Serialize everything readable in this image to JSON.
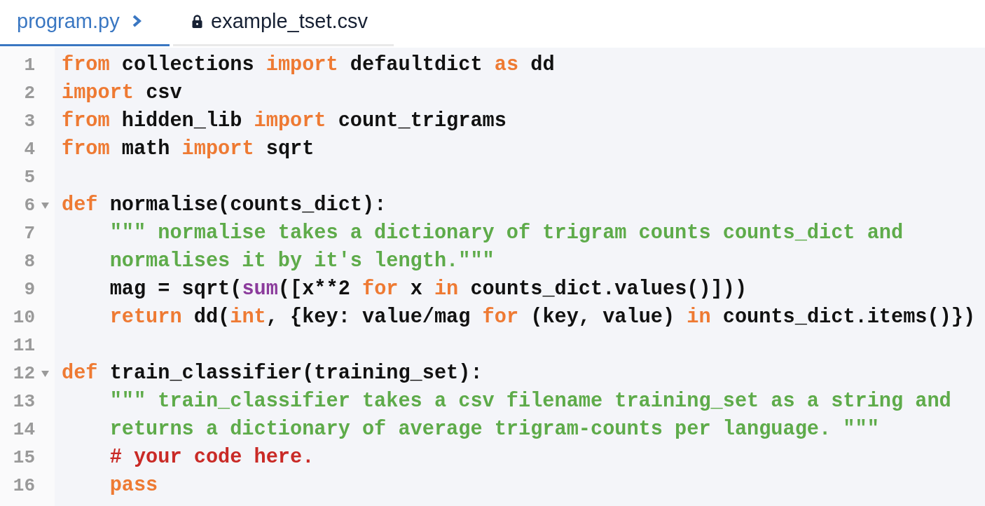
{
  "tabs": [
    {
      "label": "program.py",
      "selected": true,
      "locked": false
    },
    {
      "label": "example_tset.csv",
      "selected": false,
      "locked": true
    }
  ],
  "lines": [
    {
      "number": "1",
      "tokens": [
        {
          "kind": "keyword",
          "text": "from"
        },
        {
          "kind": "plain",
          "text": " collections "
        },
        {
          "kind": "keyword",
          "text": "import"
        },
        {
          "kind": "plain",
          "text": " defaultdict "
        },
        {
          "kind": "keyword",
          "text": "as"
        },
        {
          "kind": "plain",
          "text": " dd"
        }
      ]
    },
    {
      "number": "2",
      "tokens": [
        {
          "kind": "keyword",
          "text": "import"
        },
        {
          "kind": "plain",
          "text": " csv"
        }
      ]
    },
    {
      "number": "3",
      "tokens": [
        {
          "kind": "keyword",
          "text": "from"
        },
        {
          "kind": "plain",
          "text": " hidden_lib "
        },
        {
          "kind": "keyword",
          "text": "import"
        },
        {
          "kind": "plain",
          "text": " count_trigrams"
        }
      ]
    },
    {
      "number": "4",
      "tokens": [
        {
          "kind": "keyword",
          "text": "from"
        },
        {
          "kind": "plain",
          "text": " math "
        },
        {
          "kind": "keyword",
          "text": "import"
        },
        {
          "kind": "plain",
          "text": " sqrt"
        }
      ]
    },
    {
      "number": "5"
    },
    {
      "number": "6",
      "expanded": true,
      "tokens": [
        {
          "kind": "keyword",
          "text": "def"
        },
        {
          "kind": "plain",
          "text": " normalise(counts_dict):"
        }
      ],
      "children": [
        {
          "number": "7",
          "tokens": [
            {
              "kind": "string",
              "text": "\"\"\" normalise takes a dictionary of trigram counts counts_dict and"
            }
          ]
        },
        {
          "number": "8",
          "tokens": [
            {
              "kind": "string",
              "text": "normalises it by it's length.\"\"\""
            }
          ]
        },
        {
          "number": "9",
          "tokens": [
            {
              "kind": "plain",
              "text": "mag = sqrt("
            },
            {
              "kind": "builtin",
              "text": "sum"
            },
            {
              "kind": "plain",
              "text": "([x**2 "
            },
            {
              "kind": "keyword",
              "text": "for"
            },
            {
              "kind": "plain",
              "text": " x "
            },
            {
              "kind": "keyword",
              "text": "in"
            },
            {
              "kind": "plain",
              "text": " counts_dict.values()]))"
            }
          ]
        },
        {
          "number": "10",
          "tokens": [
            {
              "kind": "keyword",
              "text": "return"
            },
            {
              "kind": "plain",
              "text": " dd("
            },
            {
              "kind": "keyword",
              "text": "int"
            },
            {
              "kind": "plain",
              "text": ", {key: value/mag "
            },
            {
              "kind": "keyword",
              "text": "for"
            },
            {
              "kind": "plain",
              "text": " (key, value) "
            },
            {
              "kind": "keyword",
              "text": "in"
            },
            {
              "kind": "plain",
              "text": " counts_dict.items()})"
            }
          ]
        }
      ]
    },
    {
      "number": "11"
    },
    {
      "number": "12",
      "expanded": true,
      "tokens": [
        {
          "kind": "keyword",
          "text": "def"
        },
        {
          "kind": "plain",
          "text": " train_classifier(training_set):"
        }
      ],
      "children": [
        {
          "number": "13",
          "tokens": [
            {
              "kind": "string",
              "text": "\"\"\" train_classifier takes a csv filename training_set as a string and"
            }
          ]
        },
        {
          "number": "14",
          "tokens": [
            {
              "kind": "string",
              "text": "returns a dictionary of average trigram-counts per language. \"\"\""
            }
          ]
        },
        {
          "number": "15",
          "tokens": [
            {
              "kind": "comment",
              "text": "# your code here."
            }
          ]
        },
        {
          "number": "16",
          "tokens": [
            {
              "kind": "keyword",
              "text": "pass"
            }
          ]
        }
      ]
    }
  ]
}
